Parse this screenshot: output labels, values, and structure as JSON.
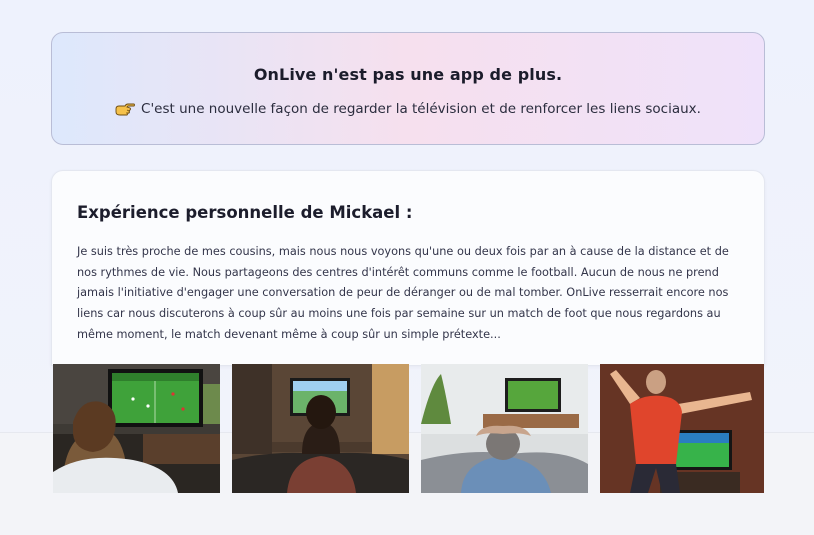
{
  "banner": {
    "title": "OnLive n'est pas une app de plus.",
    "icon": "pointing-hand-icon",
    "subtitle": "C'est une nouvelle façon de regarder la télévision et de renforcer les liens sociaux."
  },
  "testimonial": {
    "title": "Expérience personnelle de Mickael :",
    "body": "Je suis très proche de mes cousins, mais nous nous voyons qu'une ou deux fois par an à cause de la distance et de nos rythmes de vie. Nous partageons des centres d'intérêt communs comme le football. Aucun de nous ne prend jamais l'initiative d'engager une conversation de peur de déranger ou de mal tomber. OnLive resserrait encore nos liens car nous discuterons à coup sûr au moins une fois par semaine sur un match de foot que nous regardons au même moment, le match devenant même à coup sûr un simple prétexte..."
  },
  "photos": [
    {
      "subject": "boy-watching-football-tv-photo"
    },
    {
      "subject": "man-on-couch-watching-tv-photo"
    },
    {
      "subject": "man-relaxing-sofa-watching-football-photo"
    },
    {
      "subject": "man-cheering-in-front-of-tv-photo"
    }
  ],
  "colors": {
    "banner_border": "#b9bdd6",
    "pitch_green": "#3fa23a",
    "text_dark": "#1c1d2c"
  }
}
